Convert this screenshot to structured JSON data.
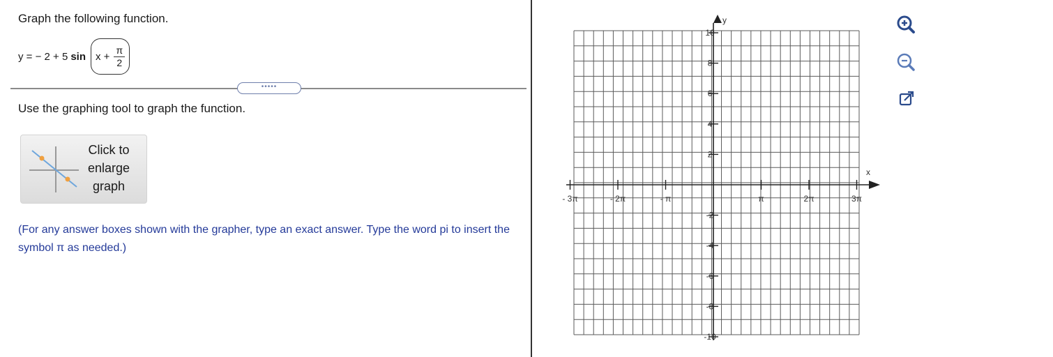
{
  "problem": {
    "title": "Graph the following function.",
    "equation": {
      "prefix": "y = − 2 + 5",
      "func": "sin",
      "arg": "x +",
      "numerator": "π",
      "denominator": "2"
    },
    "divider_handle": "•••••",
    "instruction": "Use the graphing tool to graph the function.",
    "enlarge_button": {
      "line1": "Click to",
      "line2": "enlarge",
      "line3": "graph"
    },
    "note": "(For any answer boxes shown with the grapher, type an exact answer. Type the word pi to insert the symbol π as needed.)"
  },
  "graph": {
    "x_axis_label": "x",
    "y_axis_label": "y",
    "x_tick_labels": [
      "- 3π",
      "- 2π",
      "- π",
      "π",
      "2π",
      "3π"
    ],
    "y_tick_labels": [
      "10",
      "8",
      "6",
      "4",
      "2",
      "-2",
      "-4",
      "-6",
      "-8",
      "-10"
    ],
    "y_range": [
      -10,
      10
    ],
    "x_range_in_pi": [
      -3,
      3
    ],
    "grid": true,
    "grid_color": "#5a5a5a"
  },
  "toolbar": {
    "zoom_in": "zoom-in-icon",
    "zoom_out": "zoom-out-icon",
    "popout": "popout-icon"
  }
}
